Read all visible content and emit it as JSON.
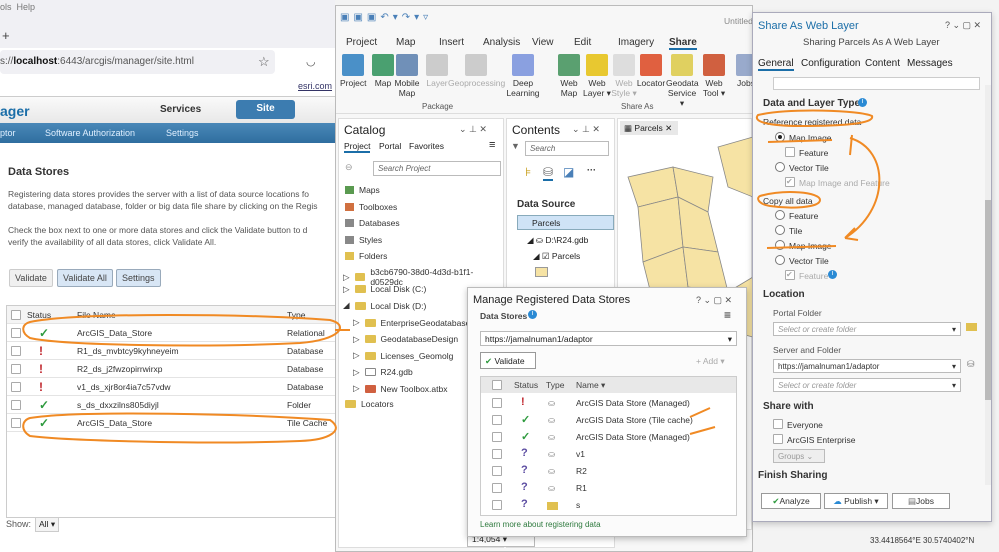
{
  "browser": {
    "menu": [
      "ols",
      "Help"
    ],
    "new_tab": "+",
    "url_prefix": "s://",
    "url_host": "localhost",
    "url_rest": ":6443/arcgis/manager/site.html",
    "esri_link": "esri.com",
    "app_title": "ager",
    "top_nav": {
      "services": "Services",
      "site": "Site"
    },
    "sub_nav": [
      "ptor",
      "Software Authorization",
      "Settings"
    ],
    "page_title": "Data Stores",
    "para1_l1": "Registering data stores provides the server with a list of data source locations fo",
    "para1_l2": "database, managed database, folder or big data file share by clicking on the Regis",
    "para2_l1": "Check the box next to one or more data stores and click the Validate button to d",
    "para2_l2": "verify the availability of all data stores, click Validate All.",
    "buttons": {
      "validate": "Validate",
      "validate_all": "Validate All",
      "settings": "Settings"
    },
    "table": {
      "headers": [
        "Status",
        "File Name",
        "Type"
      ],
      "rows": [
        {
          "status": "ok",
          "name": "ArcGIS_Data_Store",
          "type": "Relational"
        },
        {
          "status": "error",
          "name": "R1_ds_mvbtcy9kyhneyeim",
          "type": "Database"
        },
        {
          "status": "error",
          "name": "R2_ds_j2fwzopirrwirxp",
          "type": "Database"
        },
        {
          "status": "error",
          "name": "v1_ds_xjr8or4ia7c57vdw",
          "type": "Database"
        },
        {
          "status": "ok",
          "name": "s_ds_dxxzilns805diyjl",
          "type": "Folder"
        },
        {
          "status": "ok",
          "name": "ArcGIS_Data_Store",
          "type": "Tile Cache"
        }
      ]
    },
    "show_label": "Show:",
    "show_value": "All"
  },
  "pro": {
    "title": "Untitled",
    "tabs": [
      "Project",
      "Map",
      "Insert",
      "Analysis",
      "View",
      "Edit",
      "Imagery",
      "Share"
    ],
    "active_tab": "Share",
    "package": [
      "Project",
      "Map",
      "Mobile Map",
      "Layer",
      "Geoprocessing",
      "Deep Learning"
    ],
    "package_label": "Package",
    "share_as": [
      "Web Map",
      "Web Layer ▾",
      "Web Style ▾",
      "Locator",
      "Geodata Service ▾",
      "Web Tool ▾"
    ],
    "share_as_label": "Share As",
    "jobs": "Jobs",
    "catalog": {
      "title": "Catalog",
      "tabs": [
        "Project",
        "Portal",
        "Favorites"
      ],
      "search_placeholder": "Search Project",
      "items": [
        "Maps",
        "Toolboxes",
        "Databases",
        "Styles",
        "Folders"
      ],
      "folders": [
        "b3cb6790-38d0-4d3d-b1f1-d0529dc",
        "Local Disk (C:)",
        "Local Disk (D:)"
      ],
      "sub": [
        "EnterpriseGeodatabase",
        "GeodatabaseDesign",
        "Licenses_Geomolg",
        "R24.gdb",
        "New Toolbox.atbx"
      ],
      "locators": "Locators"
    },
    "contents": {
      "title": "Contents",
      "search_placeholder": "Search",
      "section": "Data Source",
      "layer": "Parcels",
      "gdb": "D:\\R24.gdb",
      "sublayer": "Parcels"
    },
    "map_tab": "Parcels",
    "scale": "1:4,054"
  },
  "mrds": {
    "title": "Manage Registered Data Stores",
    "label": "Data Stores",
    "server": "https://jamalnuman1/adaptor",
    "validate": "Validate",
    "add": "Add",
    "headers": [
      "Status",
      "Type",
      "Name ▾"
    ],
    "rows": [
      {
        "status": "error",
        "type": "db",
        "name": "ArcGIS Data Store (Managed)"
      },
      {
        "status": "ok",
        "type": "db",
        "name": "ArcGIS Data Store (Tile cache)"
      },
      {
        "status": "ok",
        "type": "db",
        "name": "ArcGIS Data Store (Managed)"
      },
      {
        "status": "unknown",
        "type": "db",
        "name": "v1"
      },
      {
        "status": "unknown",
        "type": "db",
        "name": "R2"
      },
      {
        "status": "unknown",
        "type": "db",
        "name": "R1"
      },
      {
        "status": "unknown",
        "type": "folder",
        "name": "s"
      }
    ],
    "learn_more": "Learn more about registering data"
  },
  "share": {
    "title": "Share As Web Layer",
    "subtitle": "Sharing Parcels As A Web Layer",
    "tabs": [
      "General",
      "Configuration",
      "Content",
      "Messages"
    ],
    "section_type": "Data and Layer Type",
    "ref_label": "Reference registered data",
    "ref_opts": {
      "map_image": "Map Image",
      "feature": "Feature",
      "vector_tile": "Vector Tile",
      "map_image_feature": "Map Image and Feature"
    },
    "copy_label": "Copy all data",
    "copy_opts": {
      "feature": "Feature",
      "tile": "Tile",
      "map_image": "Map Image",
      "vector_tile": "Vector Tile",
      "feature2": "Feature"
    },
    "location": "Location",
    "portal_folder": "Portal Folder",
    "folder_placeholder": "Select or create folder",
    "server_folder": "Server and Folder",
    "server": "https://jamalnuman1/adaptor",
    "share_with": "Share with",
    "everyone": "Everyone",
    "enterprise": "ArcGIS Enterprise",
    "groups": "Groups",
    "finish": "Finish Sharing",
    "analyze": "Analyze",
    "publish": "Publish",
    "jobs": "Jobs"
  },
  "status_coords": "33.4418564°E 30.5740402°N",
  "colors": {
    "ok": "#2e9a3e",
    "error": "#c0262d",
    "unknown": "#5a4aa0",
    "annot": "#f08a24",
    "accent": "#1b6ea8"
  }
}
